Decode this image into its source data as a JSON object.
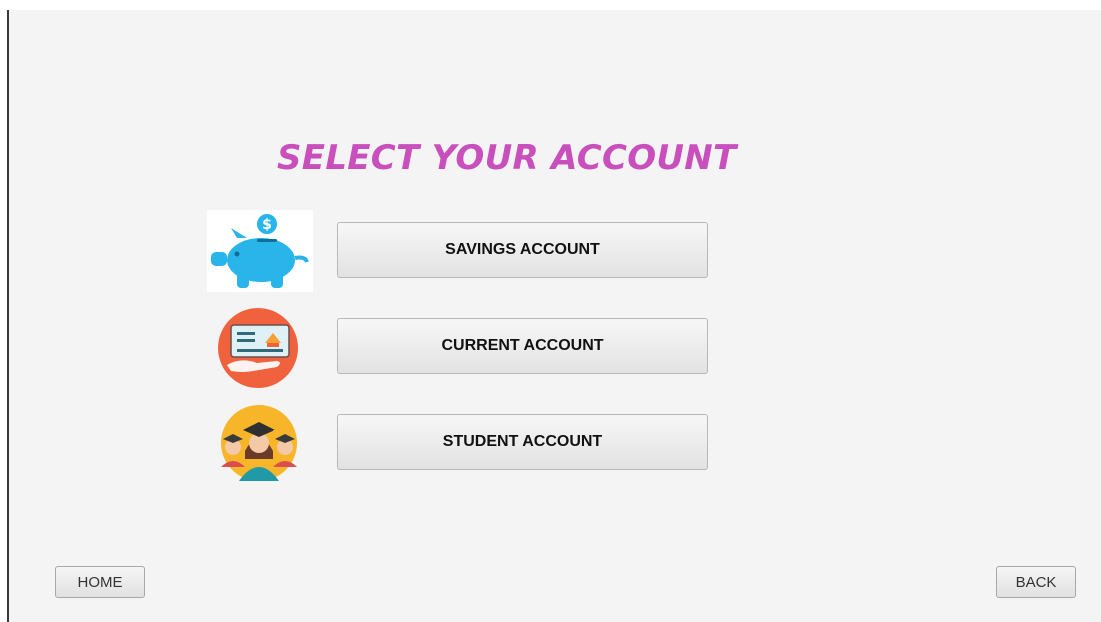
{
  "heading": "SELECT YOUR ACCOUNT",
  "accounts": [
    {
      "label": "SAVINGS ACCOUNT",
      "icon": "piggy-bank-icon"
    },
    {
      "label": "CURRENT ACCOUNT",
      "icon": "cheque-hand-icon"
    },
    {
      "label": "STUDENT ACCOUNT",
      "icon": "graduates-icon"
    }
  ],
  "nav": {
    "home": "HOME",
    "back": "BACK"
  },
  "colors": {
    "heading": "#c94fbd",
    "piggy": "#29b4ea",
    "cheque_circle": "#f0623e",
    "student_circle": "#f7b52a"
  }
}
